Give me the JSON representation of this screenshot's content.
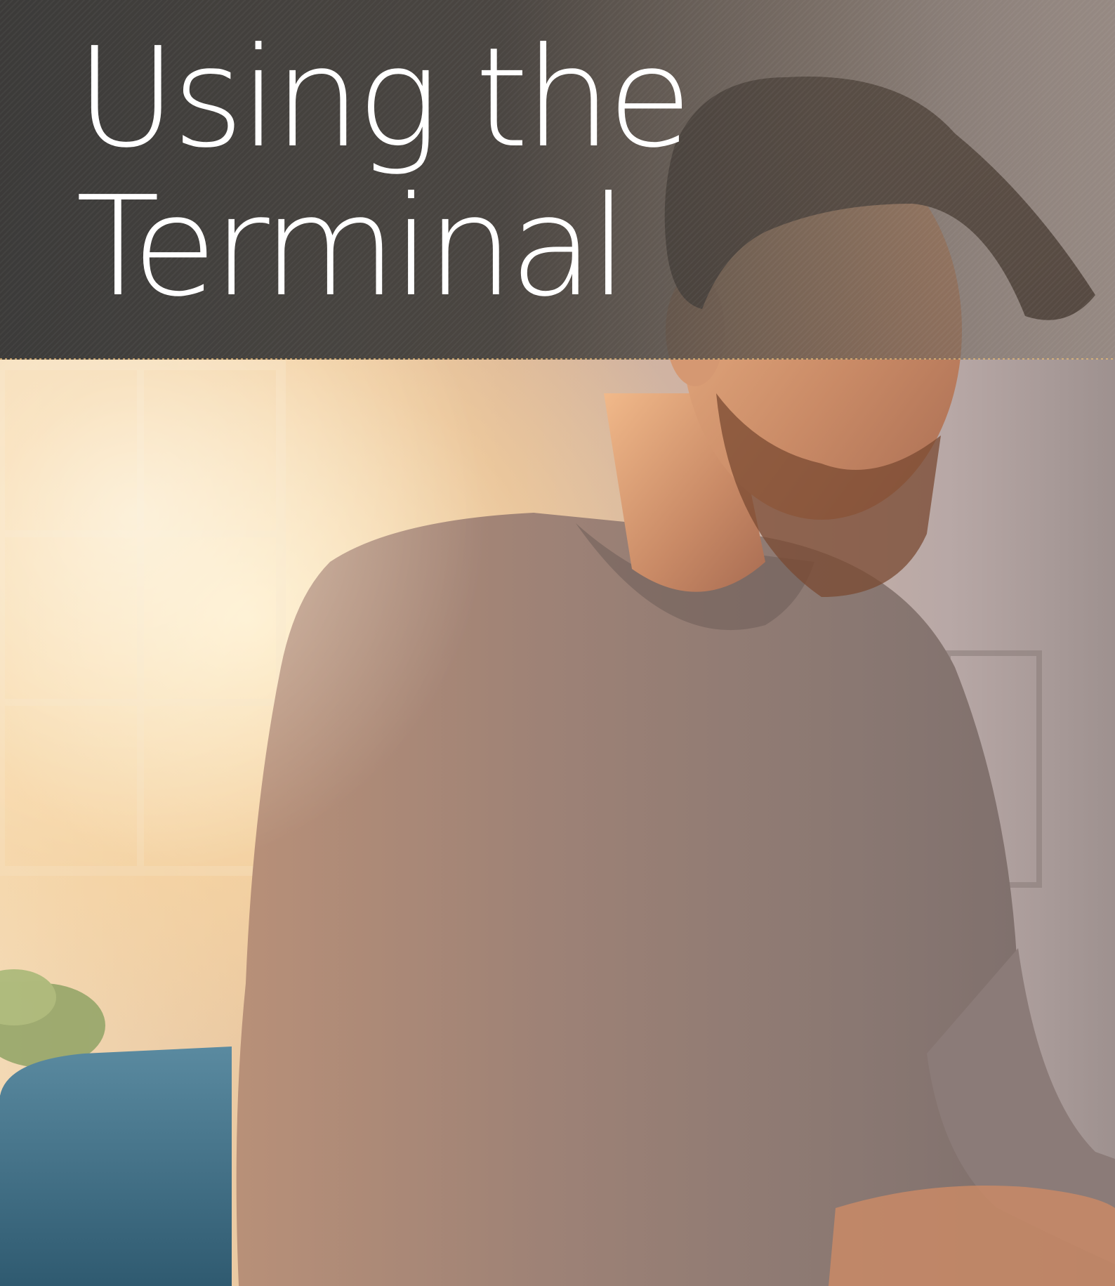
{
  "cover": {
    "title_line_1": "Using the",
    "title_line_2": "Terminal"
  },
  "photo": {
    "subject": "person-at-computer"
  },
  "colors": {
    "title_text": "#ffffff",
    "band": "#3a3a3a",
    "sweater": "#8e7a72",
    "chair": "#3f6f86"
  }
}
